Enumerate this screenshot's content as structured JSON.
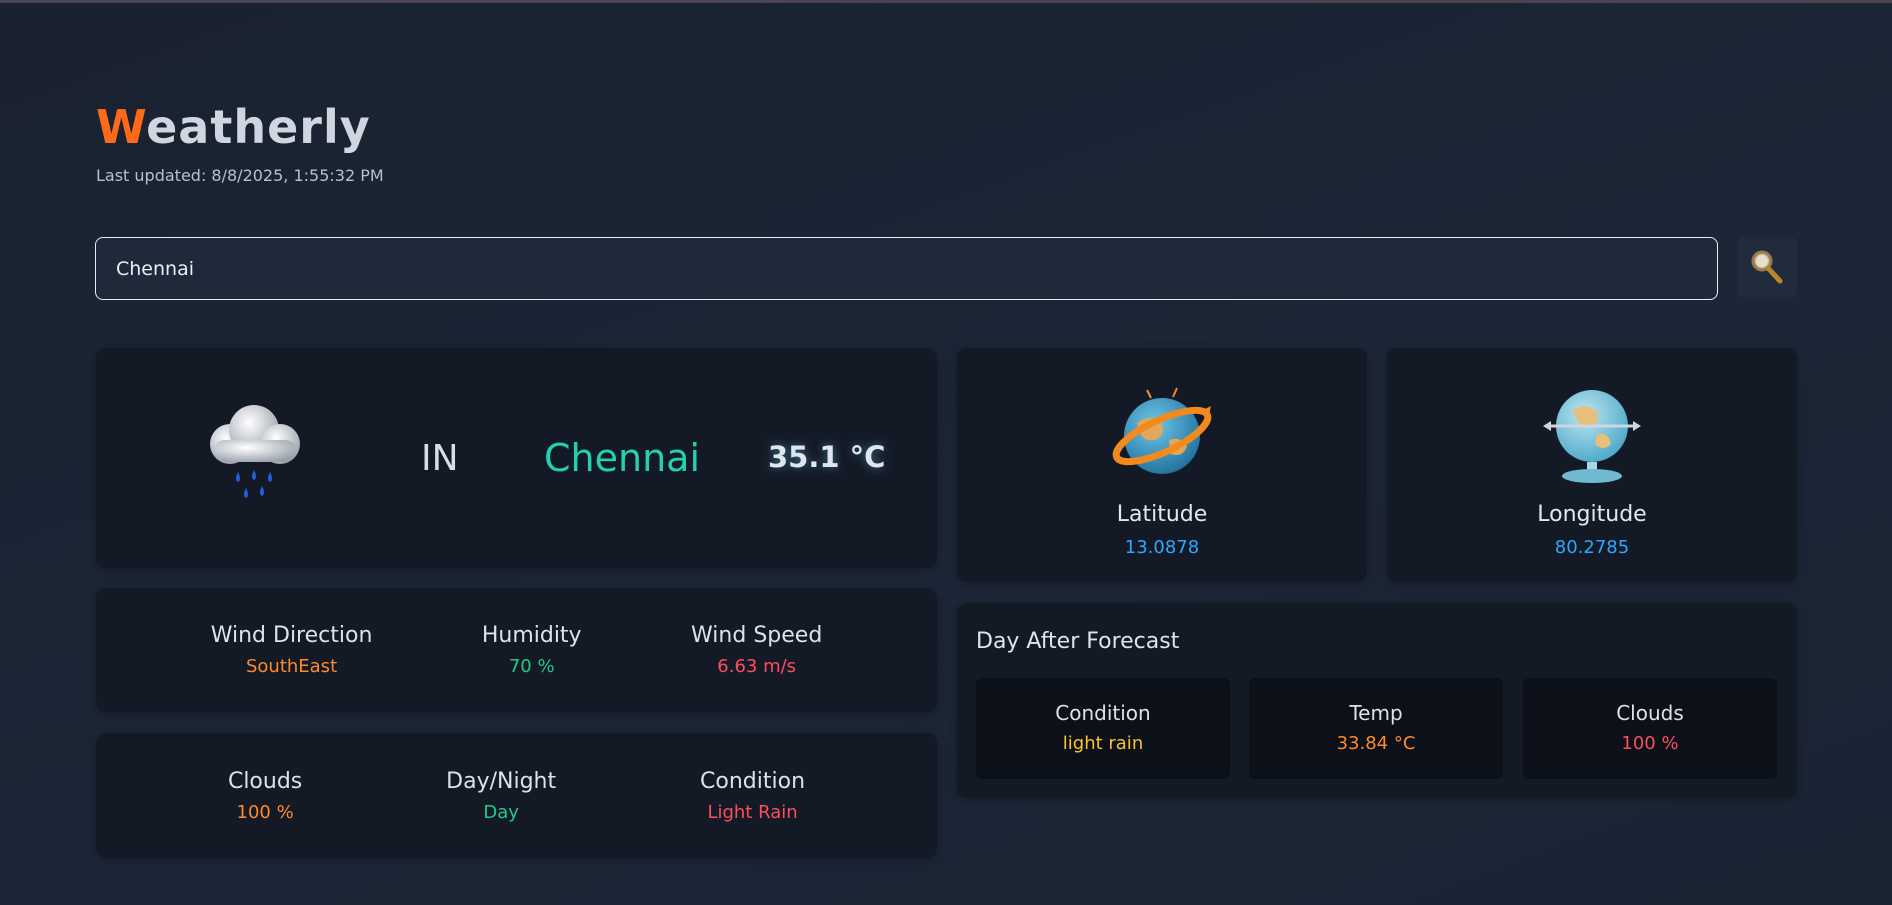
{
  "app": {
    "title_first": "W",
    "title_rest": "eatherly",
    "last_updated": "Last updated: 8/8/2025, 1:55:32 PM"
  },
  "search": {
    "value": "Chennai",
    "icon": "magnifying-glass-icon"
  },
  "current": {
    "icon": "rain-cloud-icon",
    "country": "IN",
    "city": "Chennai",
    "temperature": "35.1 °C"
  },
  "details_row1": [
    {
      "label": "Wind Direction",
      "value": "SouthEast",
      "color": "#ff8a2a"
    },
    {
      "label": "Humidity",
      "value": "70 %",
      "color": "#21c98a"
    },
    {
      "label": "Wind Speed",
      "value": "6.63 m/s",
      "color": "#ff4d5e"
    }
  ],
  "details_row2": [
    {
      "label": "Clouds",
      "value": "100 %",
      "color": "#ff8a2a"
    },
    {
      "label": "Day/Night",
      "value": "Day",
      "color": "#21c98a"
    },
    {
      "label": "Condition",
      "value": "Light Rain",
      "color": "#ff4d5e"
    }
  ],
  "coordinates": {
    "latitude": {
      "label": "Latitude",
      "value": "13.0878",
      "icon": "globe-orbit-icon"
    },
    "longitude": {
      "label": "Longitude",
      "value": "80.2785",
      "icon": "globe-stand-icon"
    }
  },
  "forecast": {
    "title": "Day After Forecast",
    "items": [
      {
        "label": "Condition",
        "value": "light rain",
        "color": "#ffc22a"
      },
      {
        "label": "Temp",
        "value": "33.84 °C",
        "color": "#ff8a2a"
      },
      {
        "label": "Clouds",
        "value": "100 %",
        "color": "#ff4d5e"
      }
    ]
  },
  "colors": {
    "accent": "#ff6a1a",
    "city": "#21d1b0",
    "coordinate_value": "#2aa8ff"
  }
}
